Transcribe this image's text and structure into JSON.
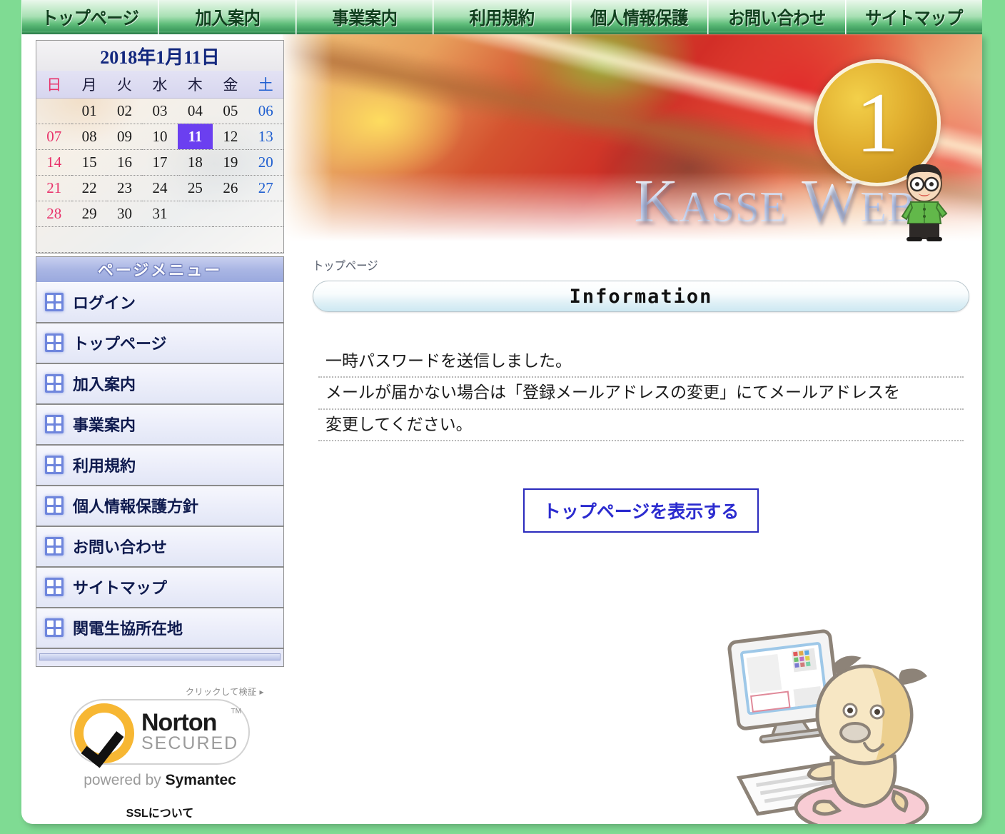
{
  "globalnav": {
    "items": [
      {
        "label": "トップページ"
      },
      {
        "label": "加入案内"
      },
      {
        "label": "事業案内"
      },
      {
        "label": "利用規約"
      },
      {
        "label": "個人情報保護"
      },
      {
        "label": "お問い合わせ"
      },
      {
        "label": "サイトマップ"
      }
    ]
  },
  "banner": {
    "month_number": "1",
    "site_logo": "Kasse Web"
  },
  "calendar": {
    "title": "2018年1月11日",
    "weekdays": [
      "日",
      "月",
      "火",
      "水",
      "木",
      "金",
      "土"
    ],
    "today": "11",
    "weeks": [
      [
        "",
        "01",
        "02",
        "03",
        "04",
        "05",
        "06"
      ],
      [
        "07",
        "08",
        "09",
        "10",
        "11",
        "12",
        "13"
      ],
      [
        "14",
        "15",
        "16",
        "17",
        "18",
        "19",
        "20"
      ],
      [
        "21",
        "22",
        "23",
        "24",
        "25",
        "26",
        "27"
      ],
      [
        "28",
        "29",
        "30",
        "31",
        "",
        "",
        ""
      ]
    ]
  },
  "page_menu": {
    "heading": "ページメニュー",
    "items": [
      {
        "label": "ログイン"
      },
      {
        "label": "トップページ"
      },
      {
        "label": "加入案内"
      },
      {
        "label": "事業案内"
      },
      {
        "label": "利用規約"
      },
      {
        "label": "個人情報保護方針"
      },
      {
        "label": "お問い合わせ"
      },
      {
        "label": "サイトマップ"
      },
      {
        "label": "関電生協所在地"
      }
    ]
  },
  "norton": {
    "click_to_verify": "クリックして検証 ▸",
    "brand": "Norton",
    "secured": "SECURED",
    "trademark": "TM",
    "powered_prefix": "powered by ",
    "powered_brand": "Symantec",
    "ssl_link": "SSLについて"
  },
  "main": {
    "breadcrumb": "トップページ",
    "section_title": "Information",
    "messages": [
      "一時パスワードを送信しました。",
      "メールが届かない場合は「登録メールアドレスの変更」にてメールアドレスを",
      "変更してください。"
    ],
    "primary_button": "トップページを表示する"
  },
  "colors": {
    "nav_green": "#3f9a5c",
    "page_background": "#7fdb93",
    "today_highlight": "#6b3ff0",
    "sunday_red": "#e8336b",
    "saturday_blue": "#1f5fd0",
    "button_blue": "#2b2bcf",
    "calendar_title_blue": "#12277e"
  }
}
